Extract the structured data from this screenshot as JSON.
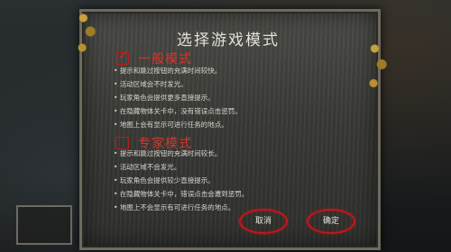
{
  "dialog": {
    "title": "选择游戏模式"
  },
  "modes": [
    {
      "label": "一般模式",
      "checked": true,
      "descriptions": [
        "提示和跳过按钮的充满时间较快。",
        "活动区域会不时发光。",
        "玩家角色会提供更多直接提示。",
        "在隐藏物体关卡中，没有错误点击惩罚。",
        "地图上会有显示可进行任务的地点。"
      ]
    },
    {
      "label": "专家模式",
      "checked": false,
      "descriptions": [
        "提示和跳过按钮的充满时间较长。",
        "活动区域不会发光。",
        "玩家角色会提供较少直接提示。",
        "在隐藏物体关卡中，错误点击会遭到惩罚。",
        "地图上不会显示有可进行任务的地点。"
      ]
    }
  ],
  "buttons": {
    "cancel_label": "取消",
    "confirm_label": "确定"
  },
  "colors": {
    "accent_red": "#c4161c",
    "mode_label": "#d3392b",
    "text": "#d8d6cf"
  }
}
